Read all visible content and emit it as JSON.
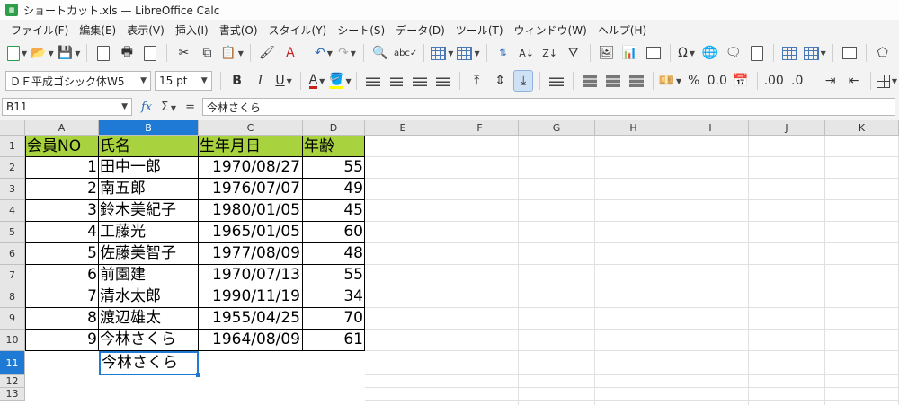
{
  "window": {
    "title": "ショートカット.xls — LibreOffice Calc",
    "app_icon_text": "Calc"
  },
  "menu": [
    "ファイル(F)",
    "編集(E)",
    "表示(V)",
    "挿入(I)",
    "書式(O)",
    "スタイル(Y)",
    "シート(S)",
    "データ(D)",
    "ツール(T)",
    "ウィンドウ(W)",
    "ヘルプ(H)"
  ],
  "format_toolbar": {
    "font_name": "ＤＦ平成ゴシック体W5",
    "font_size": "15 pt",
    "bold": "B",
    "italic": "I",
    "underline": "U",
    "font_color": "A",
    "percent": "%",
    "decimal": "0.0",
    "add_decimal": ".00",
    "remove_decimal": ".0",
    "highlight_color": "#ffff00",
    "font_color_value": "#c9211e"
  },
  "formula_bar": {
    "name_box": "B11",
    "fx": "fx",
    "sum": "Σ",
    "equals": "=",
    "content": "今林さくら"
  },
  "sheet": {
    "columns": [
      "A",
      "B",
      "C",
      "D",
      "E",
      "F",
      "G",
      "H",
      "I",
      "J",
      "K"
    ],
    "selected_column": "B",
    "rows": [
      "1",
      "2",
      "3",
      "4",
      "5",
      "6",
      "7",
      "8",
      "9",
      "10",
      "11",
      "12",
      "13"
    ],
    "selected_row": "11",
    "header_fill": "#a9d23f",
    "headers": [
      "会員NO",
      "氏名",
      "生年月日",
      "年齢"
    ],
    "records": [
      {
        "no": "1",
        "name": "田中一郎",
        "dob": "1970/08/27",
        "age": "55"
      },
      {
        "no": "2",
        "name": "南五郎",
        "dob": "1976/07/07",
        "age": "49"
      },
      {
        "no": "3",
        "name": "鈴木美紀子",
        "dob": "1980/01/05",
        "age": "45"
      },
      {
        "no": "4",
        "name": "工藤光",
        "dob": "1965/01/05",
        "age": "60"
      },
      {
        "no": "5",
        "name": "佐藤美智子",
        "dob": "1977/08/09",
        "age": "48"
      },
      {
        "no": "6",
        "name": "前園建",
        "dob": "1970/07/13",
        "age": "55"
      },
      {
        "no": "7",
        "name": "清水太郎",
        "dob": "1990/11/19",
        "age": "34"
      },
      {
        "no": "8",
        "name": "渡辺雄太",
        "dob": "1955/04/25",
        "age": "70"
      },
      {
        "no": "9",
        "name": "今林さくら",
        "dob": "1964/08/09",
        "age": "61"
      }
    ],
    "active_cell_value": "今林さくら"
  }
}
